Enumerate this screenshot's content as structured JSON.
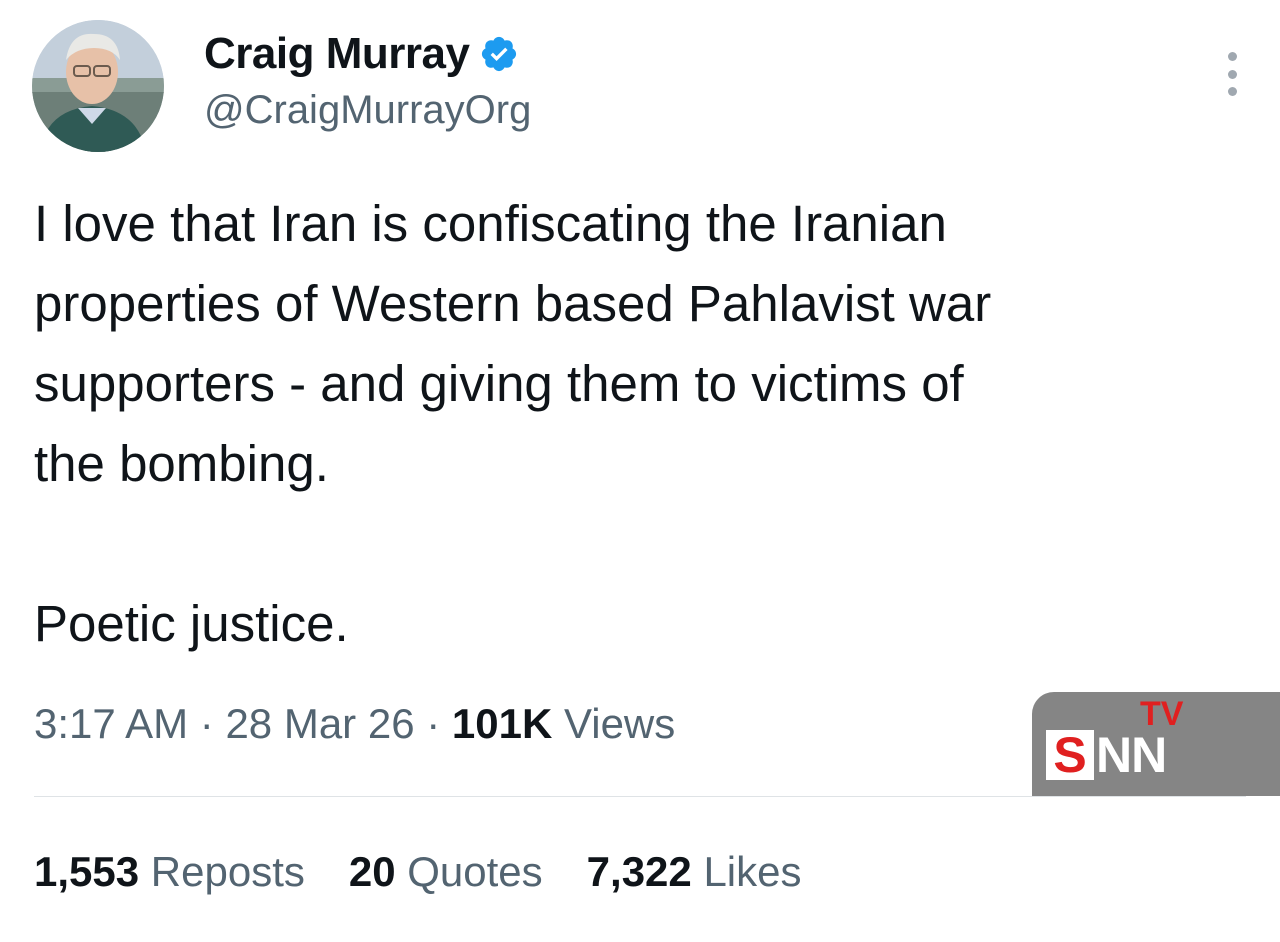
{
  "author": {
    "display_name": "Craig Murray",
    "handle": "@CraigMurrayOrg",
    "verified": true
  },
  "tweet": {
    "lines": [
      "I love that Iran is confiscating the Iranian",
      "properties of Western based Pahlavist war",
      "supporters - and giving them to victims of",
      "the bombing.",
      "Poetic justice."
    ]
  },
  "meta": {
    "time": "3:17 AM",
    "date": "28 Mar 26",
    "views_count": "101K",
    "views_label": "Views",
    "separator": "·"
  },
  "stats": {
    "reposts_count": "1,553",
    "reposts_label": "Reposts",
    "quotes_count": "20",
    "quotes_label": "Quotes",
    "likes_count": "7,322",
    "likes_label": "Likes"
  },
  "watermark": {
    "top": "TV",
    "s": "S",
    "nn": "NN"
  },
  "icons": {
    "verified": "verified-badge-icon",
    "more": "more-options-icon"
  },
  "colors": {
    "text": "#0f1419",
    "secondary": "#536471",
    "verified_blue": "#1d9bf0",
    "watermark_bg": "#858585",
    "watermark_red": "#e02020"
  }
}
